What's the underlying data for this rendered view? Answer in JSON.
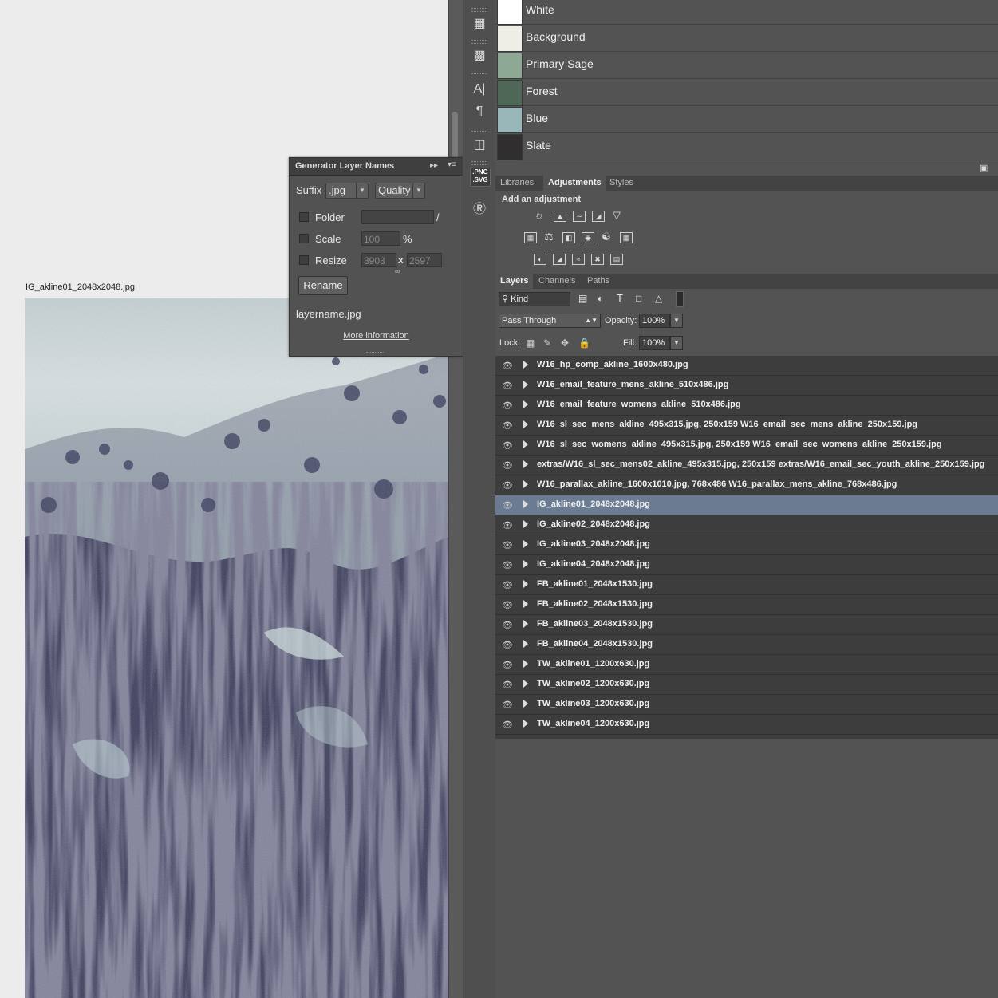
{
  "document": {
    "title": "IG_akline01_2048x2048.jpg"
  },
  "swatches": [
    {
      "name": "White",
      "color": "#ffffff"
    },
    {
      "name": "Background",
      "color": "#eeede6"
    },
    {
      "name": "Primary Sage",
      "color": "#8ea896"
    },
    {
      "name": "Forest",
      "color": "#4f6757"
    },
    {
      "name": "Blue",
      "color": "#99b6b8"
    },
    {
      "name": "Slate",
      "color": "#312e30"
    }
  ],
  "generator_panel": {
    "title": "Generator Layer Names",
    "suffix_label": "Suffix",
    "suffix_value": ".jpg",
    "quality_label": "Quality",
    "folder_label": "Folder",
    "folder_slash": "/",
    "scale_label": "Scale",
    "scale_value": "100",
    "scale_unit": "%",
    "resize_label": "Resize",
    "resize_w": "3903",
    "resize_x": "x",
    "resize_h": "2597",
    "rename_label": "Rename",
    "preview": "layername.jpg",
    "more_info": "More information"
  },
  "adjustments": {
    "tabs": [
      "Libraries",
      "Adjustments",
      "Styles"
    ],
    "active_tab": "Adjustments",
    "title": "Add an adjustment"
  },
  "layers_panel": {
    "tabs": [
      "Layers",
      "Channels",
      "Paths"
    ],
    "active_tab": "Layers",
    "filter_label": "Kind",
    "blend_mode": "Pass Through",
    "opacity_label": "Opacity:",
    "opacity_value": "100%",
    "lock_label": "Lock:",
    "fill_label": "Fill:",
    "fill_value": "100%",
    "selected_layer": "IG_akline01_2048x2048.jpg",
    "layers": [
      "W16_hp_comp_akline_1600x480.jpg",
      "W16_email_feature_mens_akline_510x486.jpg",
      "W16_email_feature_womens_akline_510x486.jpg",
      "W16_sl_sec_mens_akline_495x315.jpg, 250x159 W16_email_sec_mens_akline_250x159.jpg",
      "W16_sl_sec_womens_akline_495x315.jpg, 250x159 W16_email_sec_womens_akline_250x159.jpg",
      "extras/W16_sl_sec_mens02_akline_495x315.jpg, 250x159 extras/W16_email_sec_youth_akline_250x159.jpg",
      "W16_parallax_akline_1600x1010.jpg, 768x486 W16_parallax_mens_akline_768x486.jpg",
      "IG_akline01_2048x2048.jpg",
      "IG_akline02_2048x2048.jpg",
      "IG_akline03_2048x2048.jpg",
      "IG_akline04_2048x2048.jpg",
      "FB_akline01_2048x1530.jpg",
      "FB_akline02_2048x1530.jpg",
      "FB_akline03_2048x1530.jpg",
      "FB_akline04_2048x1530.jpg",
      "TW_akline01_1200x630.jpg",
      "TW_akline02_1200x630.jpg",
      "TW_akline03_1200x630.jpg",
      "TW_akline04_1200x630.jpg"
    ]
  },
  "dock": {
    "png_badge_1": ".PNG",
    "png_badge_2": ".SVG"
  }
}
